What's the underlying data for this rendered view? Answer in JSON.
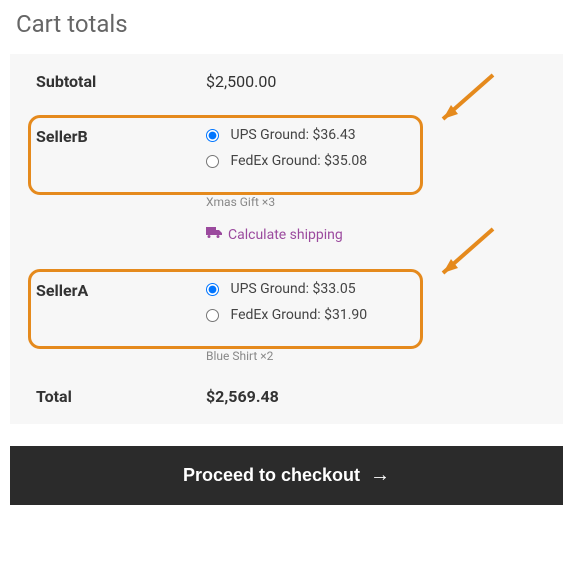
{
  "title": "Cart totals",
  "subtotal": {
    "label": "Subtotal",
    "value": "$2,500.00"
  },
  "sellers": [
    {
      "name": "SellerB",
      "options": [
        {
          "label": "UPS Ground:",
          "price": "$36.43",
          "selected": true
        },
        {
          "label": "FedEx Ground:",
          "price": "$35.08",
          "selected": false
        }
      ],
      "items": "Xmas Gift ×3"
    },
    {
      "name": "SellerA",
      "options": [
        {
          "label": "UPS Ground:",
          "price": "$33.05",
          "selected": true
        },
        {
          "label": "FedEx Ground:",
          "price": "$31.90",
          "selected": false
        }
      ],
      "items": "Blue Shirt ×2"
    }
  ],
  "calculate_shipping": "Calculate shipping",
  "total": {
    "label": "Total",
    "value": "$2,569.48"
  },
  "checkout": "Proceed to checkout"
}
